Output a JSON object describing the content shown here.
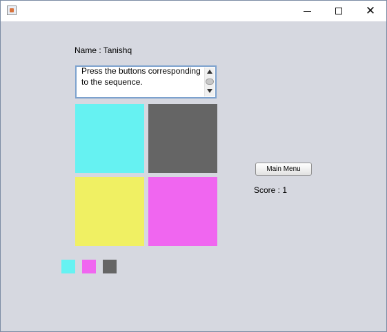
{
  "window": {
    "controls": {
      "minimize_icon": "minimize-icon",
      "maximize_icon": "maximize-icon",
      "close_icon": "close-icon",
      "close_glyph": "✕"
    }
  },
  "game": {
    "name_label": "Name : Tanishq",
    "instructions": "Press the buttons corresponding to the sequence.",
    "main_menu_label": "Main Menu",
    "score_label": "Score : 1",
    "pads": [
      {
        "name": "cyan",
        "color": "#66f2f2"
      },
      {
        "name": "gray",
        "color": "#656565"
      },
      {
        "name": "yellow",
        "color": "#f0f063"
      },
      {
        "name": "magenta",
        "color": "#f066f0"
      }
    ],
    "sequence": [
      {
        "color": "#66f2f2"
      },
      {
        "color": "#f066f0"
      },
      {
        "color": "#656565"
      }
    ]
  }
}
